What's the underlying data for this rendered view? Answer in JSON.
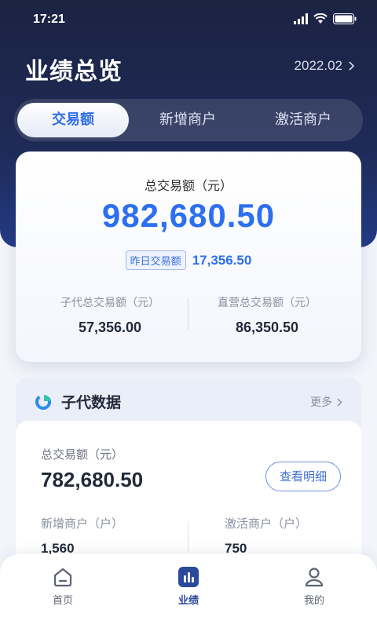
{
  "status_bar": {
    "time": "17:21"
  },
  "header": {
    "title": "业绩总览",
    "period": "2022.02"
  },
  "tabs": [
    {
      "label": "交易额",
      "active": true
    },
    {
      "label": "新增商户",
      "active": false
    },
    {
      "label": "激活商户",
      "active": false
    }
  ],
  "summary": {
    "label": "总交易额（元）",
    "value": "982,680.50",
    "yesterday_label": "昨日交易额",
    "yesterday_value": "17,356.50",
    "left_label": "子代总交易额（元）",
    "left_value": "57,356.00",
    "right_label": "直营总交易额（元）",
    "right_value": "86,350.50"
  },
  "sub_panel": {
    "title": "子代数据",
    "more_label": "更多",
    "total_label": "总交易额（元）",
    "total_value": "782,680.50",
    "detail_button": "查看明细",
    "new_label": "新增商户（户）",
    "new_value": "1,560",
    "active_label": "激活商户（户）",
    "active_value": "750"
  },
  "tabbar": [
    {
      "label": "首页",
      "icon": "home-icon",
      "active": false
    },
    {
      "label": "业绩",
      "icon": "chart-icon",
      "active": true
    },
    {
      "label": "我的",
      "icon": "user-icon",
      "active": false
    }
  ],
  "colors": {
    "accent": "#2c6ff0",
    "header_bg": "#1b2342"
  }
}
